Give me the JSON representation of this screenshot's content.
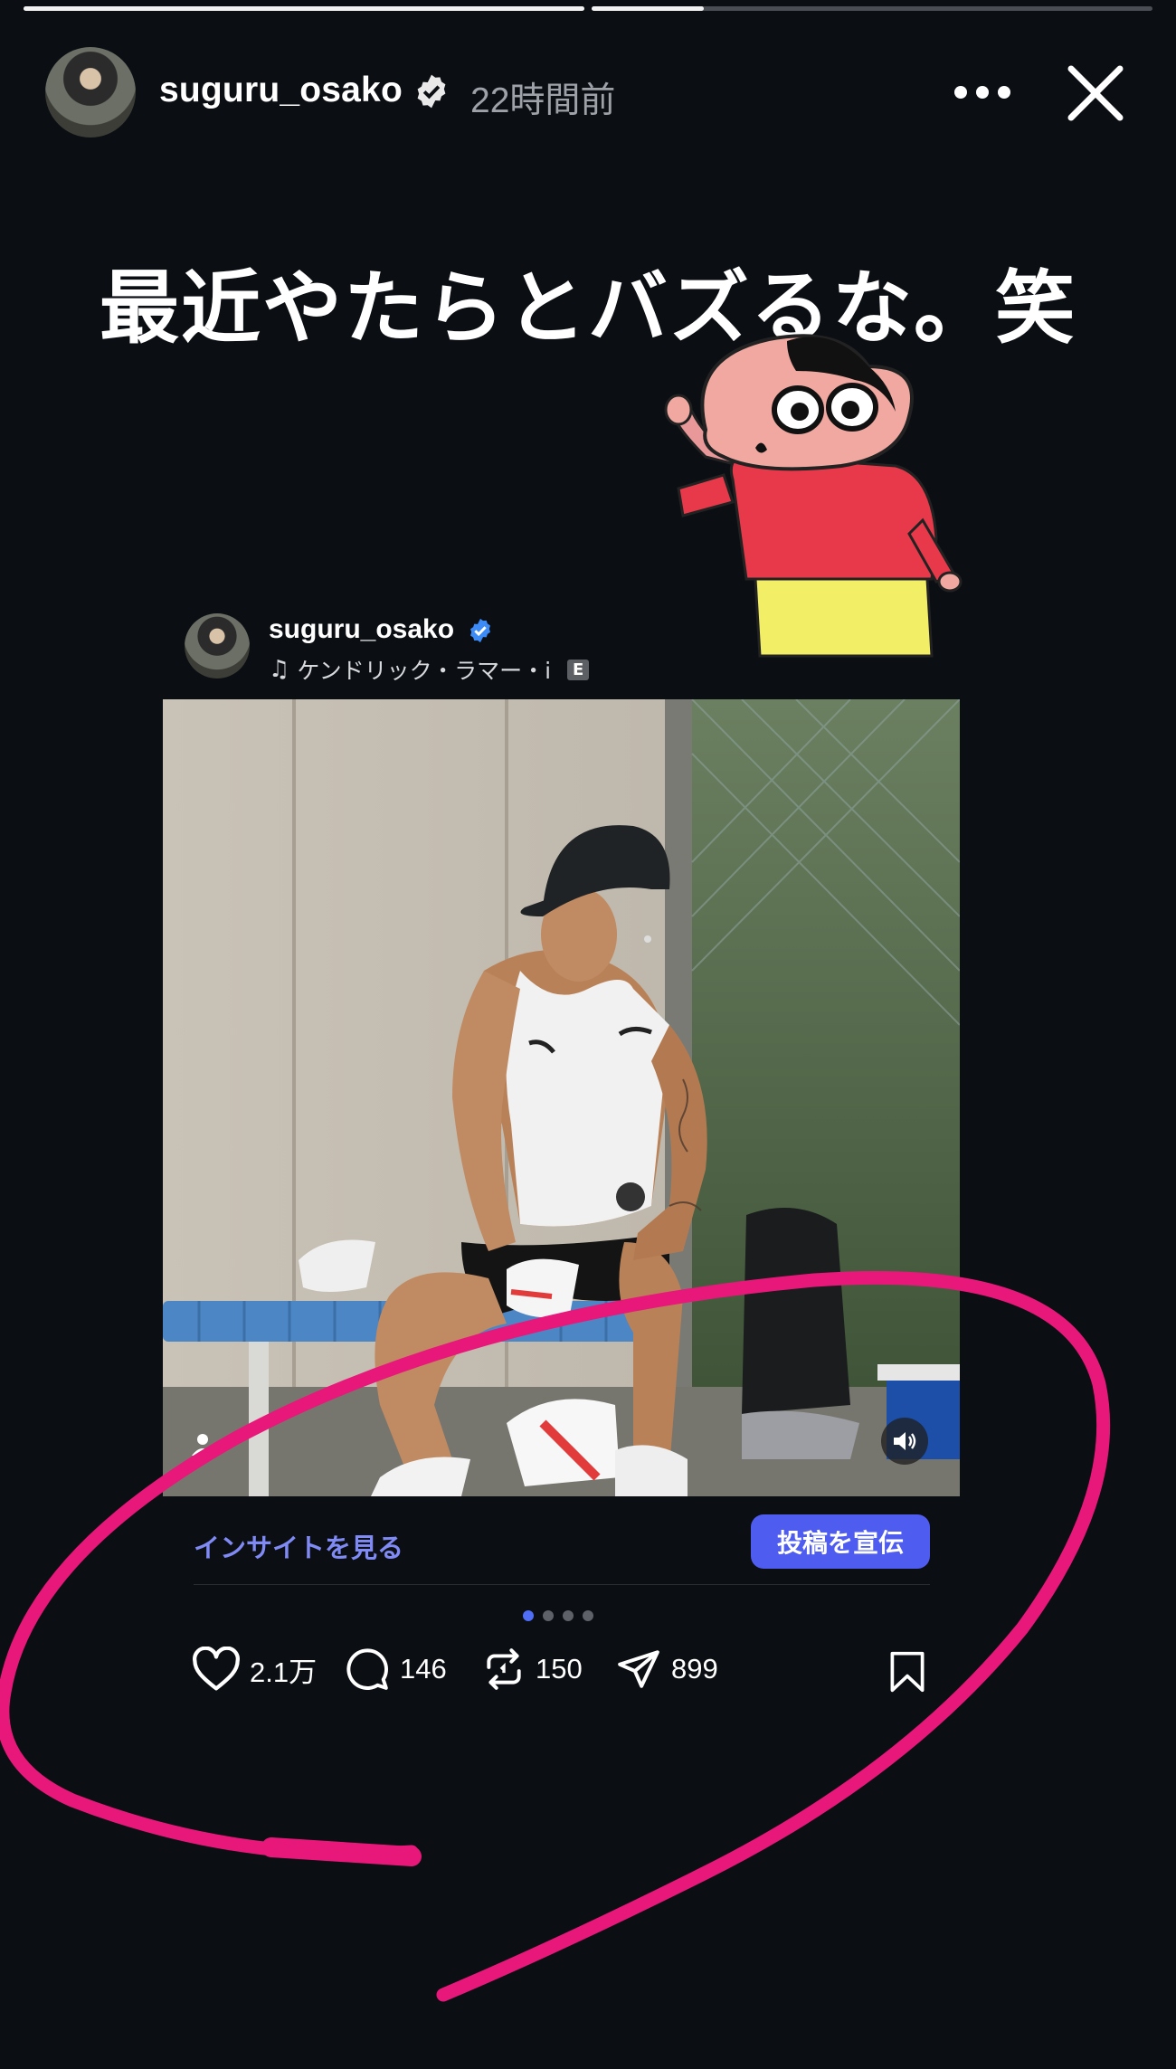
{
  "story": {
    "progress": [
      1.0,
      0.2
    ],
    "username": "suguru_osako",
    "time_ago": "22時間前",
    "caption": "最近やたらとバズるな。笑"
  },
  "post": {
    "username": "suguru_osako",
    "music": "ケンドリック・ラマー・i",
    "explicit_badge": "E",
    "insights_label": "インサイトを見る",
    "promote_label": "投稿を宣伝",
    "carousel_total": 4,
    "carousel_active": 1,
    "likes": "2.1万",
    "comments": "146",
    "reposts": "150",
    "shares": "899"
  },
  "colors": {
    "background": "#0b0e13",
    "accent_blue": "#4f5cf0",
    "link_blue": "#7f8af5",
    "scribble_pink": "#e8187a"
  }
}
